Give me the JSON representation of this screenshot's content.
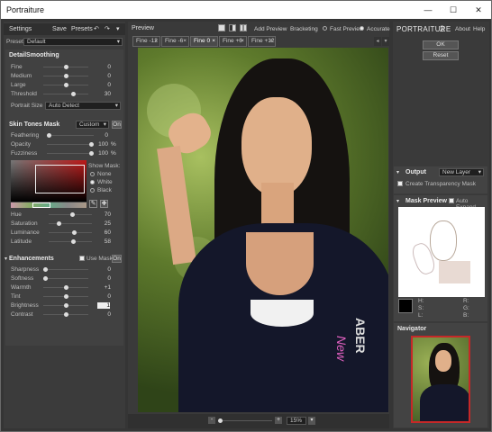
{
  "window": {
    "title": "Portraiture",
    "minimize": "—",
    "maximize": "☐",
    "close": "✕"
  },
  "settings": {
    "title": "Settings",
    "save": "Save",
    "presets": "Presets",
    "preset_label": "Preset",
    "preset_value": "Default",
    "detail": {
      "title": "DetailSmoothing",
      "rows": [
        {
          "label": "Fine",
          "value": "0",
          "level": 0.5
        },
        {
          "label": "Medium",
          "value": "0",
          "level": 0.5
        },
        {
          "label": "Large",
          "value": "0",
          "level": 0.5
        },
        {
          "label": "Threshold",
          "value": "30",
          "level": 0.7
        }
      ],
      "portrait_size_label": "Portrait Size",
      "portrait_size_value": "Auto Detect"
    },
    "skin": {
      "title": "Skin Tones Mask",
      "mode": "Custom",
      "toggle": "On",
      "rows": [
        {
          "label": "Feathering",
          "value": "0",
          "unit": "",
          "level": 0.0
        },
        {
          "label": "Opacity",
          "value": "100",
          "unit": "%",
          "level": 1.0
        },
        {
          "label": "Fuzziness",
          "value": "100",
          "unit": "%",
          "level": 1.0
        }
      ],
      "show_mask": "Show Mask:",
      "mask_opts": [
        "None",
        "White",
        "Black"
      ],
      "hsl": [
        {
          "label": "Hue",
          "value": "70",
          "level": 0.55
        },
        {
          "label": "Saturation",
          "value": "25",
          "level": 0.2
        },
        {
          "label": "Luminance",
          "value": "60",
          "level": 0.6
        },
        {
          "label": "Latitude",
          "value": "58",
          "level": 0.58
        }
      ]
    },
    "enh": {
      "title": "Enhancements",
      "use_mask": "Use Mask",
      "toggle": "On",
      "rows": [
        {
          "label": "Sharpness",
          "value": "0",
          "level": 0.0
        },
        {
          "label": "Softness",
          "value": "0",
          "level": 0.0
        },
        {
          "label": "Warmth",
          "value": "+1",
          "level": 0.52
        },
        {
          "label": "Tint",
          "value": "0",
          "level": 0.5
        },
        {
          "label": "Brightness",
          "value": "1",
          "level": 0.52
        },
        {
          "label": "Contrast",
          "value": "0",
          "level": 0.5
        }
      ]
    }
  },
  "preview": {
    "title": "Preview",
    "add_preview": "Add Preview",
    "bracketing": "Bracketing",
    "fast_preview": "Fast Preview",
    "accurate": "Accurate",
    "tabs": [
      "Fine -12",
      "Fine -6",
      "Fine 0",
      "Fine +6",
      "Fine +12"
    ],
    "active_tab": 2,
    "zoom": "15%"
  },
  "right": {
    "brand": "PORTRAITURE",
    "version": "2",
    "about": "About",
    "help": "Help",
    "ok": "OK",
    "reset": "Reset",
    "output_title": "Output",
    "output_value": "New Layer",
    "transparency": "Create Transparency Mask",
    "mask_title": "Mask Preview",
    "auto_expand": "Auto Expand",
    "hsl_labels": [
      "H:",
      "S:",
      "L:"
    ],
    "rgb_labels": [
      "R:",
      "G:",
      "B:"
    ],
    "navigator": "Navigator"
  },
  "colors": {
    "accent": "#c62828",
    "bg": "#353535"
  }
}
